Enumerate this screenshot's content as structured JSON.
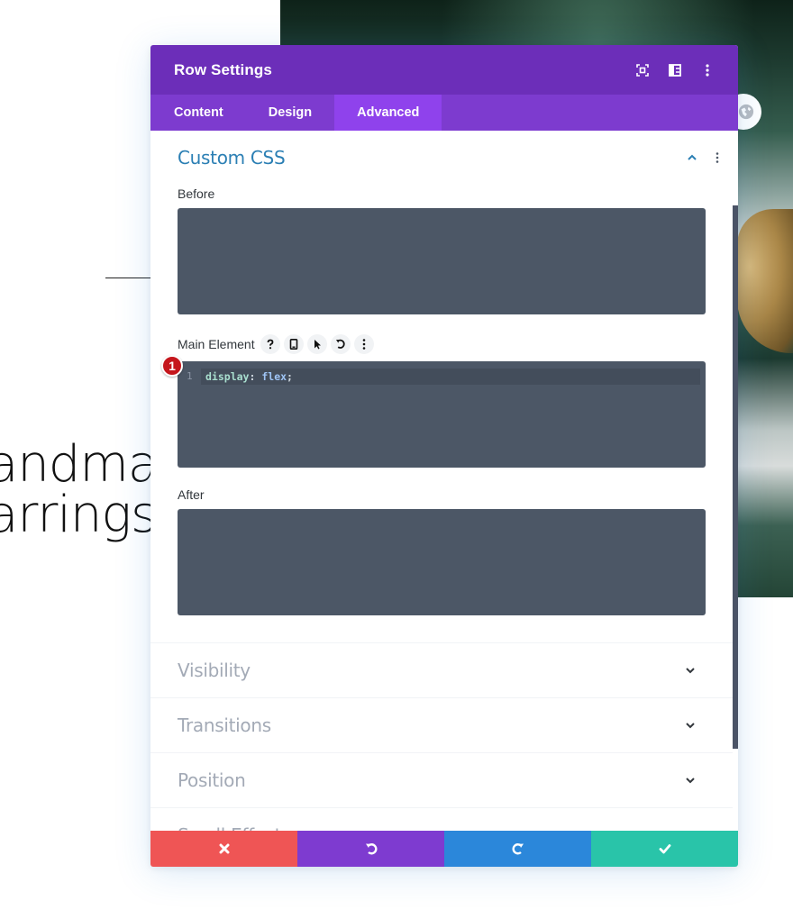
{
  "background": {
    "heading_lines": [
      "andma",
      "arrings"
    ]
  },
  "modal": {
    "title": "Row Settings",
    "header_icons": [
      "focus-mode-icon",
      "split-view-icon",
      "more-options-icon"
    ],
    "tabs": [
      {
        "label": "Content",
        "active": false
      },
      {
        "label": "Design",
        "active": false
      },
      {
        "label": "Advanced",
        "active": true
      }
    ],
    "sections": {
      "custom_css": {
        "title": "Custom CSS",
        "expanded": true,
        "fields": {
          "before": {
            "label": "Before",
            "value": ""
          },
          "main_element": {
            "label": "Main Element",
            "controls": [
              "help-icon",
              "responsive-icon",
              "hover-icon",
              "reset-icon",
              "more-icon"
            ],
            "badge": "1",
            "line_number": "1",
            "code": {
              "property": "display",
              "colon": ":",
              "value": "flex",
              "semicolon": ";"
            }
          },
          "after": {
            "label": "After",
            "value": ""
          }
        }
      },
      "collapsed": [
        {
          "title": "Visibility"
        },
        {
          "title": "Transitions"
        },
        {
          "title": "Position"
        },
        {
          "title": "Scroll Effects"
        }
      ]
    },
    "footer": [
      {
        "action": "discard",
        "icon": "close-icon",
        "color": "#ef5555"
      },
      {
        "action": "undo",
        "icon": "undo-icon",
        "color": "#7e3bd0"
      },
      {
        "action": "redo",
        "icon": "redo-icon",
        "color": "#2b87da"
      },
      {
        "action": "save",
        "icon": "check-icon",
        "color": "#29c4a9"
      }
    ]
  },
  "colors": {
    "header": "#6c2eb9",
    "tabs": "#7d3bcf",
    "tab_active": "#8f42ec",
    "section_title": "#2b7fb4",
    "code_bg": "#4c5766",
    "badge": "#c5161c"
  }
}
